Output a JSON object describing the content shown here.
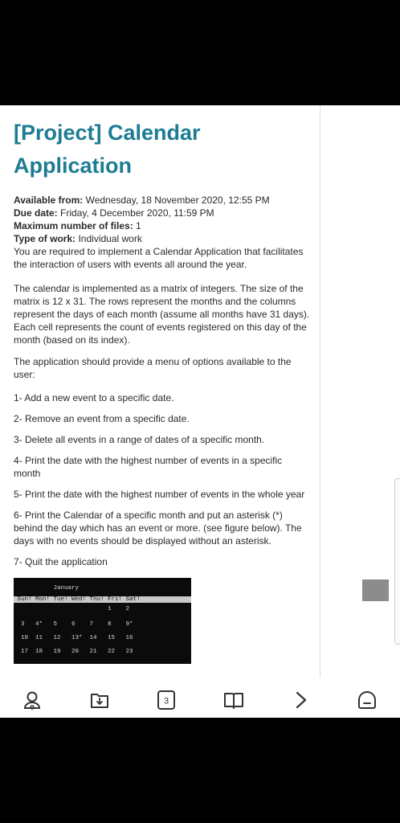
{
  "document": {
    "title": "[Project] Calendar Application",
    "meta": [
      {
        "label": "Available from:",
        "value": "Wednesday, 18 November 2020, 12:55 PM"
      },
      {
        "label": "Due date:",
        "value": "Friday, 4 December 2020, 11:59 PM"
      },
      {
        "label": "Maximum number of files:",
        "value": "1"
      },
      {
        "label": "Type of work:",
        "value": "Individual work"
      }
    ],
    "intro": "You are required to implement a Calendar Application that facilitates the interaction of users with events all around the year.",
    "para1": "The calendar is implemented as a matrix of integers. The size of the matrix is 12 x 31. The rows represent the months and the columns represent the days of each month (assume all months have 31 days). Each cell represents the count of events registered on this day of the month (based on its index).",
    "para2": "The application should provide a menu of options available to the user:",
    "options": [
      "1- Add a new event to a specific date.",
      "2- Remove an event from a specific date.",
      "3- Delete all events in a range of dates of a specific month.",
      "4- Print the date with the highest number of events in a specific month",
      "5- Print the date with the highest number of events in the whole year",
      "6- Print the Calendar of a specific month and put an asterisk (*) behind the day which has an event or more. (see figure below). The days with no events should be displayed without an asterisk.",
      "7- Quit the application"
    ]
  },
  "terminal": {
    "lines": [
      "           January",
      " Sun! Mon! Tue! Wed! Thu! Fri! Sat!",
      "                          1    2",
      "  3   4*   5    6    7    8    9*",
      "  10  11   12   13*  14   15   16",
      "  17  18   19   20   21   22   23"
    ]
  },
  "tabbar": {
    "items": [
      {
        "name": "profile-icon"
      },
      {
        "name": "download-icon"
      },
      {
        "name": "tabs-count-button",
        "label": "3"
      },
      {
        "name": "book-icon"
      },
      {
        "name": "chevron-right-icon"
      },
      {
        "name": "home-icon"
      }
    ]
  },
  "colors": {
    "title": "#1d7c93",
    "terminal_bg": "#0b0b0b"
  }
}
